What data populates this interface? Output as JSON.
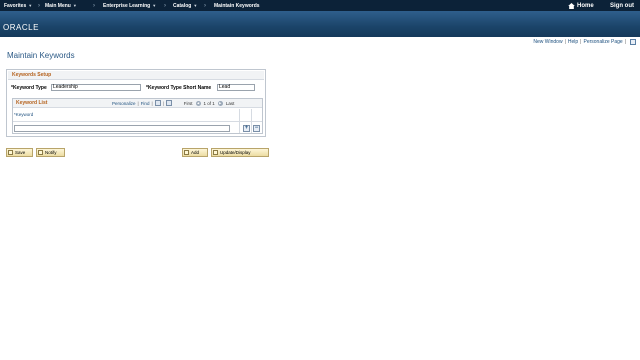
{
  "nav": {
    "items": [
      {
        "label": "Favorites",
        "arrow": true
      },
      {
        "label": "Main Menu",
        "arrow": true
      },
      {
        "label": "Enterprise Learning",
        "arrow": true
      },
      {
        "label": "Catalog",
        "arrow": true
      },
      {
        "label": "Maintain Keywords",
        "arrow": false
      }
    ],
    "home": "Home",
    "signout": "Sign out",
    "logo": "ORACLE"
  },
  "utility": {
    "new_window": "New Window",
    "help": "Help",
    "personalize_page": "Personalize Page"
  },
  "page_title": "Maintain Keywords",
  "keywords_setup": {
    "heading": "Keywords Setup",
    "keyword_type_label": "*Keyword Type",
    "keyword_type_value": "Leadership",
    "short_name_label": "*Keyword Type Short Name",
    "short_name_value": "Lead"
  },
  "keyword_list": {
    "title": "Keyword List",
    "personalize": "Personalize",
    "find": "Find",
    "first": "First",
    "range": "1 of 1",
    "last": "Last",
    "column_header": "*Keyword",
    "row_value": ""
  },
  "buttons": {
    "save": "Save",
    "notify": "Notify",
    "add": "Add",
    "update_display": "Update/Display"
  }
}
